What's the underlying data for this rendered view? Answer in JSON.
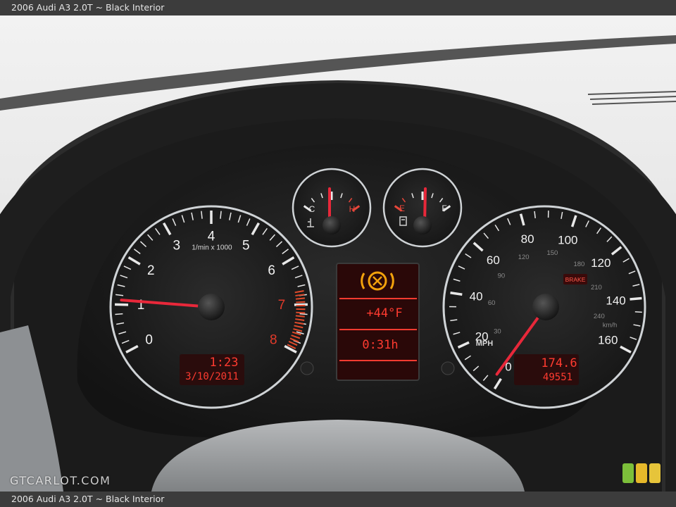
{
  "caption": "2006 Audi A3 2.0T ~ Black Interior",
  "watermark": "GTCARLOT.COM",
  "tachometer": {
    "labels": [
      "0",
      "1",
      "2",
      "3",
      "4",
      "5",
      "6",
      "7",
      "8"
    ],
    "unit": "1/min x 1000",
    "needle_value": 1.1,
    "max": 8
  },
  "speedometer": {
    "mph_labels": [
      "0",
      "20",
      "40",
      "60",
      "80",
      "100",
      "120",
      "140",
      "160"
    ],
    "kmh_labels": [
      "30",
      "60",
      "90",
      "120",
      "150",
      "180",
      "210",
      "240"
    ],
    "mph_unit": "MPH",
    "kmh_unit": "km/h",
    "brake_text": "BRAKE",
    "needle_value": 0
  },
  "temp_gauge": {
    "cold_label": "C",
    "hot_label": "H"
  },
  "fuel_gauge": {
    "empty_label": "E",
    "full_label": "F"
  },
  "left_display": {
    "clock": "1:23",
    "date": "3/10/2011"
  },
  "center_display": {
    "outside_temp": "+44°F",
    "trip_time": "0:31h"
  },
  "right_display": {
    "trip": "174.6",
    "odometer": "49551"
  },
  "colors": {
    "lcd_red": "#ff3b30",
    "needle_red": "#e8283a",
    "warning_amber": "#f2a20c",
    "caption_bar": "#3c3c3c"
  },
  "icons": {
    "warning": "parking-brake-warning-icon",
    "fuel_pump": "fuel-pump-icon",
    "coolant": "coolant-temperature-icon"
  }
}
